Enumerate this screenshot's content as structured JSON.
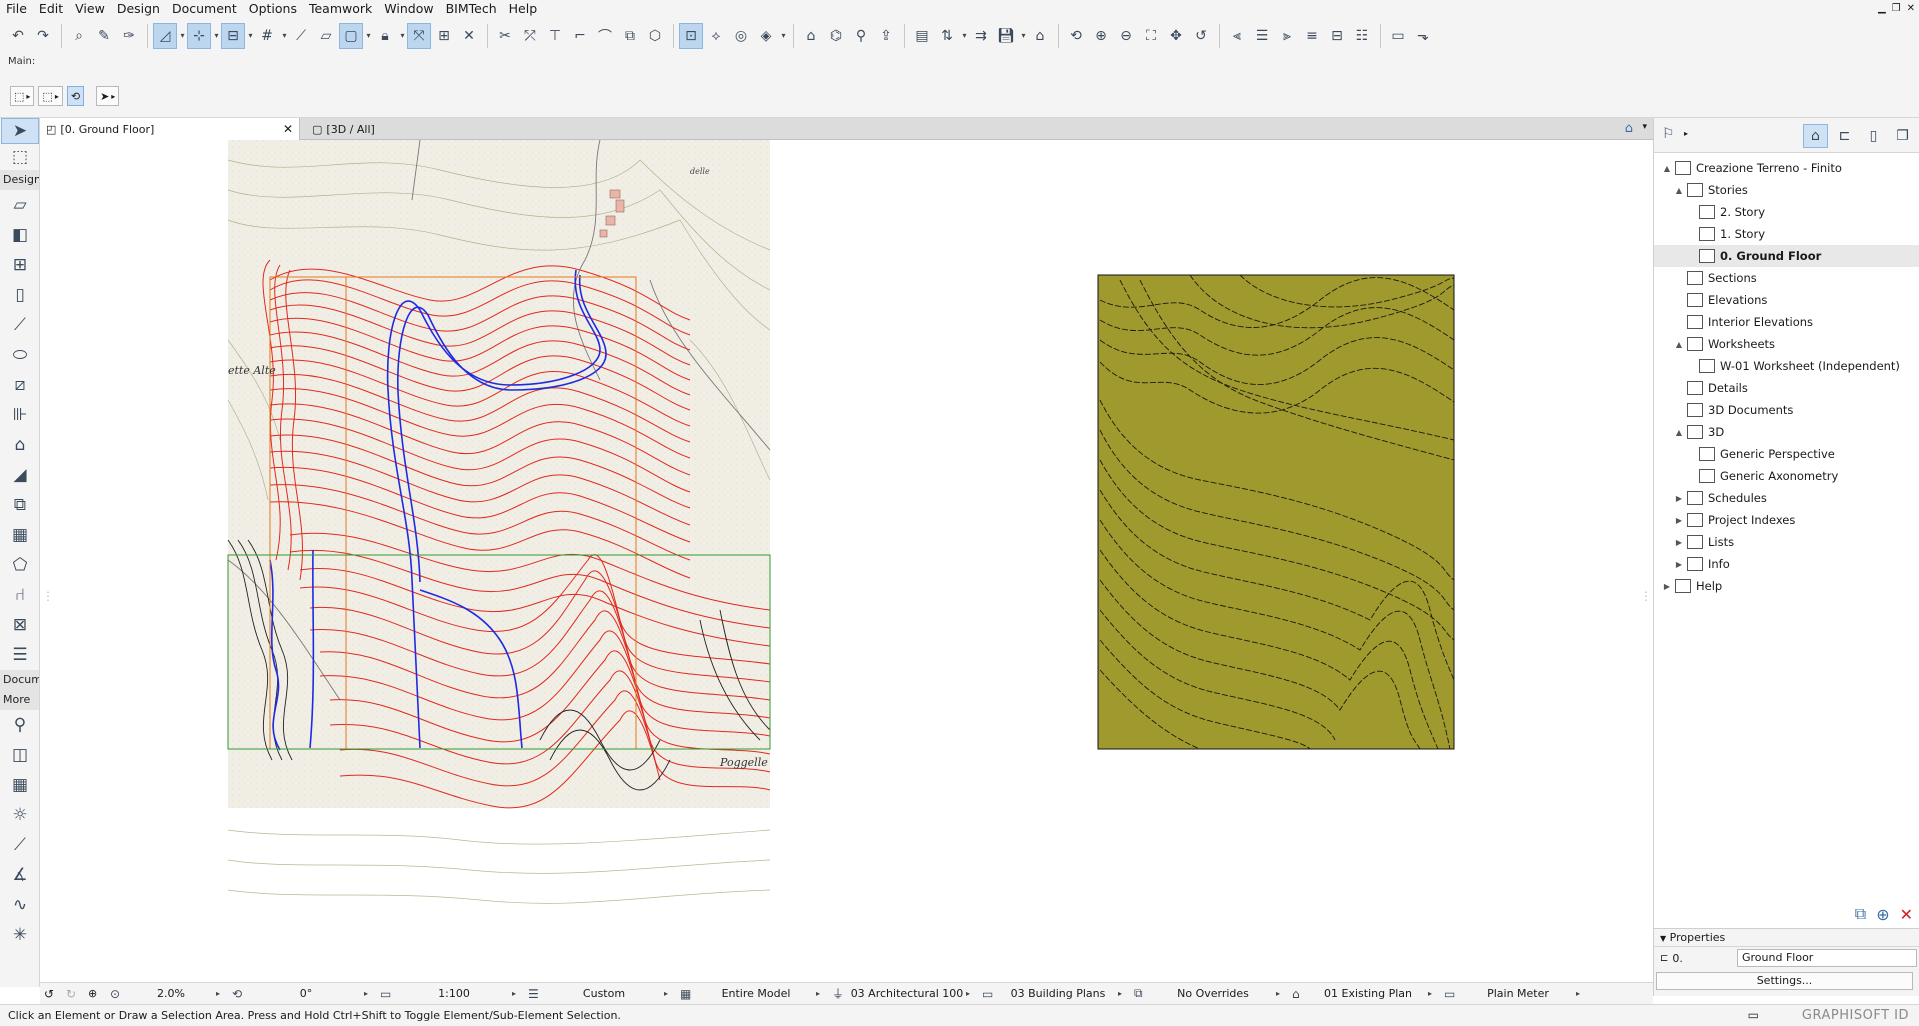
{
  "menu": [
    "File",
    "Edit",
    "View",
    "Design",
    "Document",
    "Options",
    "Teamwork",
    "Window",
    "BIMTech",
    "Help"
  ],
  "infobox": {
    "main_label": "Main:"
  },
  "toolbox": {
    "design_header": "Design",
    "document_header": "Docum",
    "more_header": "More"
  },
  "tabs": [
    {
      "label": "[0. Ground Floor]"
    },
    {
      "label": "[3D / All]"
    }
  ],
  "navigator": {
    "tree": [
      {
        "label": "Creazione Terreno - Finito",
        "icon": "project-icon",
        "depth": 0,
        "arrow": "▲"
      },
      {
        "label": "Stories",
        "icon": "stories-icon",
        "depth": 1,
        "arrow": "▲"
      },
      {
        "label": "2. Story",
        "icon": "story-icon",
        "depth": 2,
        "arrow": ""
      },
      {
        "label": "1. Story",
        "icon": "story-icon",
        "depth": 2,
        "arrow": ""
      },
      {
        "label": "0. Ground Floor",
        "icon": "story-icon",
        "depth": 2,
        "arrow": "",
        "selected": true
      },
      {
        "label": "Sections",
        "icon": "section-icon",
        "depth": 1,
        "arrow": ""
      },
      {
        "label": "Elevations",
        "icon": "elevation-icon",
        "depth": 1,
        "arrow": ""
      },
      {
        "label": "Interior Elevations",
        "icon": "interior-elevation-icon",
        "depth": 1,
        "arrow": ""
      },
      {
        "label": "Worksheets",
        "icon": "worksheet-icon",
        "depth": 1,
        "arrow": "▲"
      },
      {
        "label": "W-01 Worksheet (Independent)",
        "icon": "worksheet-icon",
        "depth": 2,
        "arrow": ""
      },
      {
        "label": "Details",
        "icon": "detail-icon",
        "depth": 1,
        "arrow": ""
      },
      {
        "label": "3D Documents",
        "icon": "3d-document-icon",
        "depth": 1,
        "arrow": ""
      },
      {
        "label": "3D",
        "icon": "3d-icon",
        "depth": 1,
        "arrow": "▲"
      },
      {
        "label": "Generic Perspective",
        "icon": "perspective-icon",
        "depth": 2,
        "arrow": ""
      },
      {
        "label": "Generic Axonometry",
        "icon": "axonometry-icon",
        "depth": 2,
        "arrow": ""
      },
      {
        "label": "Schedules",
        "icon": "schedule-icon",
        "depth": 1,
        "arrow": "▶"
      },
      {
        "label": "Project Indexes",
        "icon": "index-icon",
        "depth": 1,
        "arrow": "▶"
      },
      {
        "label": "Lists",
        "icon": "list-icon",
        "depth": 1,
        "arrow": "▶"
      },
      {
        "label": "Info",
        "icon": "info-icon",
        "depth": 1,
        "arrow": "▶"
      },
      {
        "label": "Help",
        "icon": "help-icon",
        "depth": 0,
        "arrow": "▶"
      }
    ]
  },
  "properties": {
    "header": "Properties",
    "id": "0.",
    "name": "Ground Floor",
    "settings_label": "Settings..."
  },
  "quick_options": {
    "zoom": "2.0%",
    "angle": "0°",
    "scale": "1:100",
    "layer": "Custom",
    "model": "Entire Model",
    "pen_set": "03 Architectural 100",
    "mvo": "03 Building Plans",
    "override": "No Overrides",
    "renovation": "01 Existing Plan",
    "dimension": "Plain Meter"
  },
  "status": {
    "text": "Click an Element or Draw a Selection Area. Press and Hold Ctrl+Shift to Toggle Element/Sub-Element Selection.",
    "brand": "GRAPHISOFT ID"
  },
  "map_labels": {
    "label_alte": "ette  Alte",
    "label_poggelle": "Poggelle",
    "label_delle": "delle"
  },
  "colors": {
    "terrain_fill": "#a09a2e",
    "contour_red": "#e02a1e",
    "river_blue": "#1f2be0",
    "selection_blue": "#cfe1f4"
  }
}
